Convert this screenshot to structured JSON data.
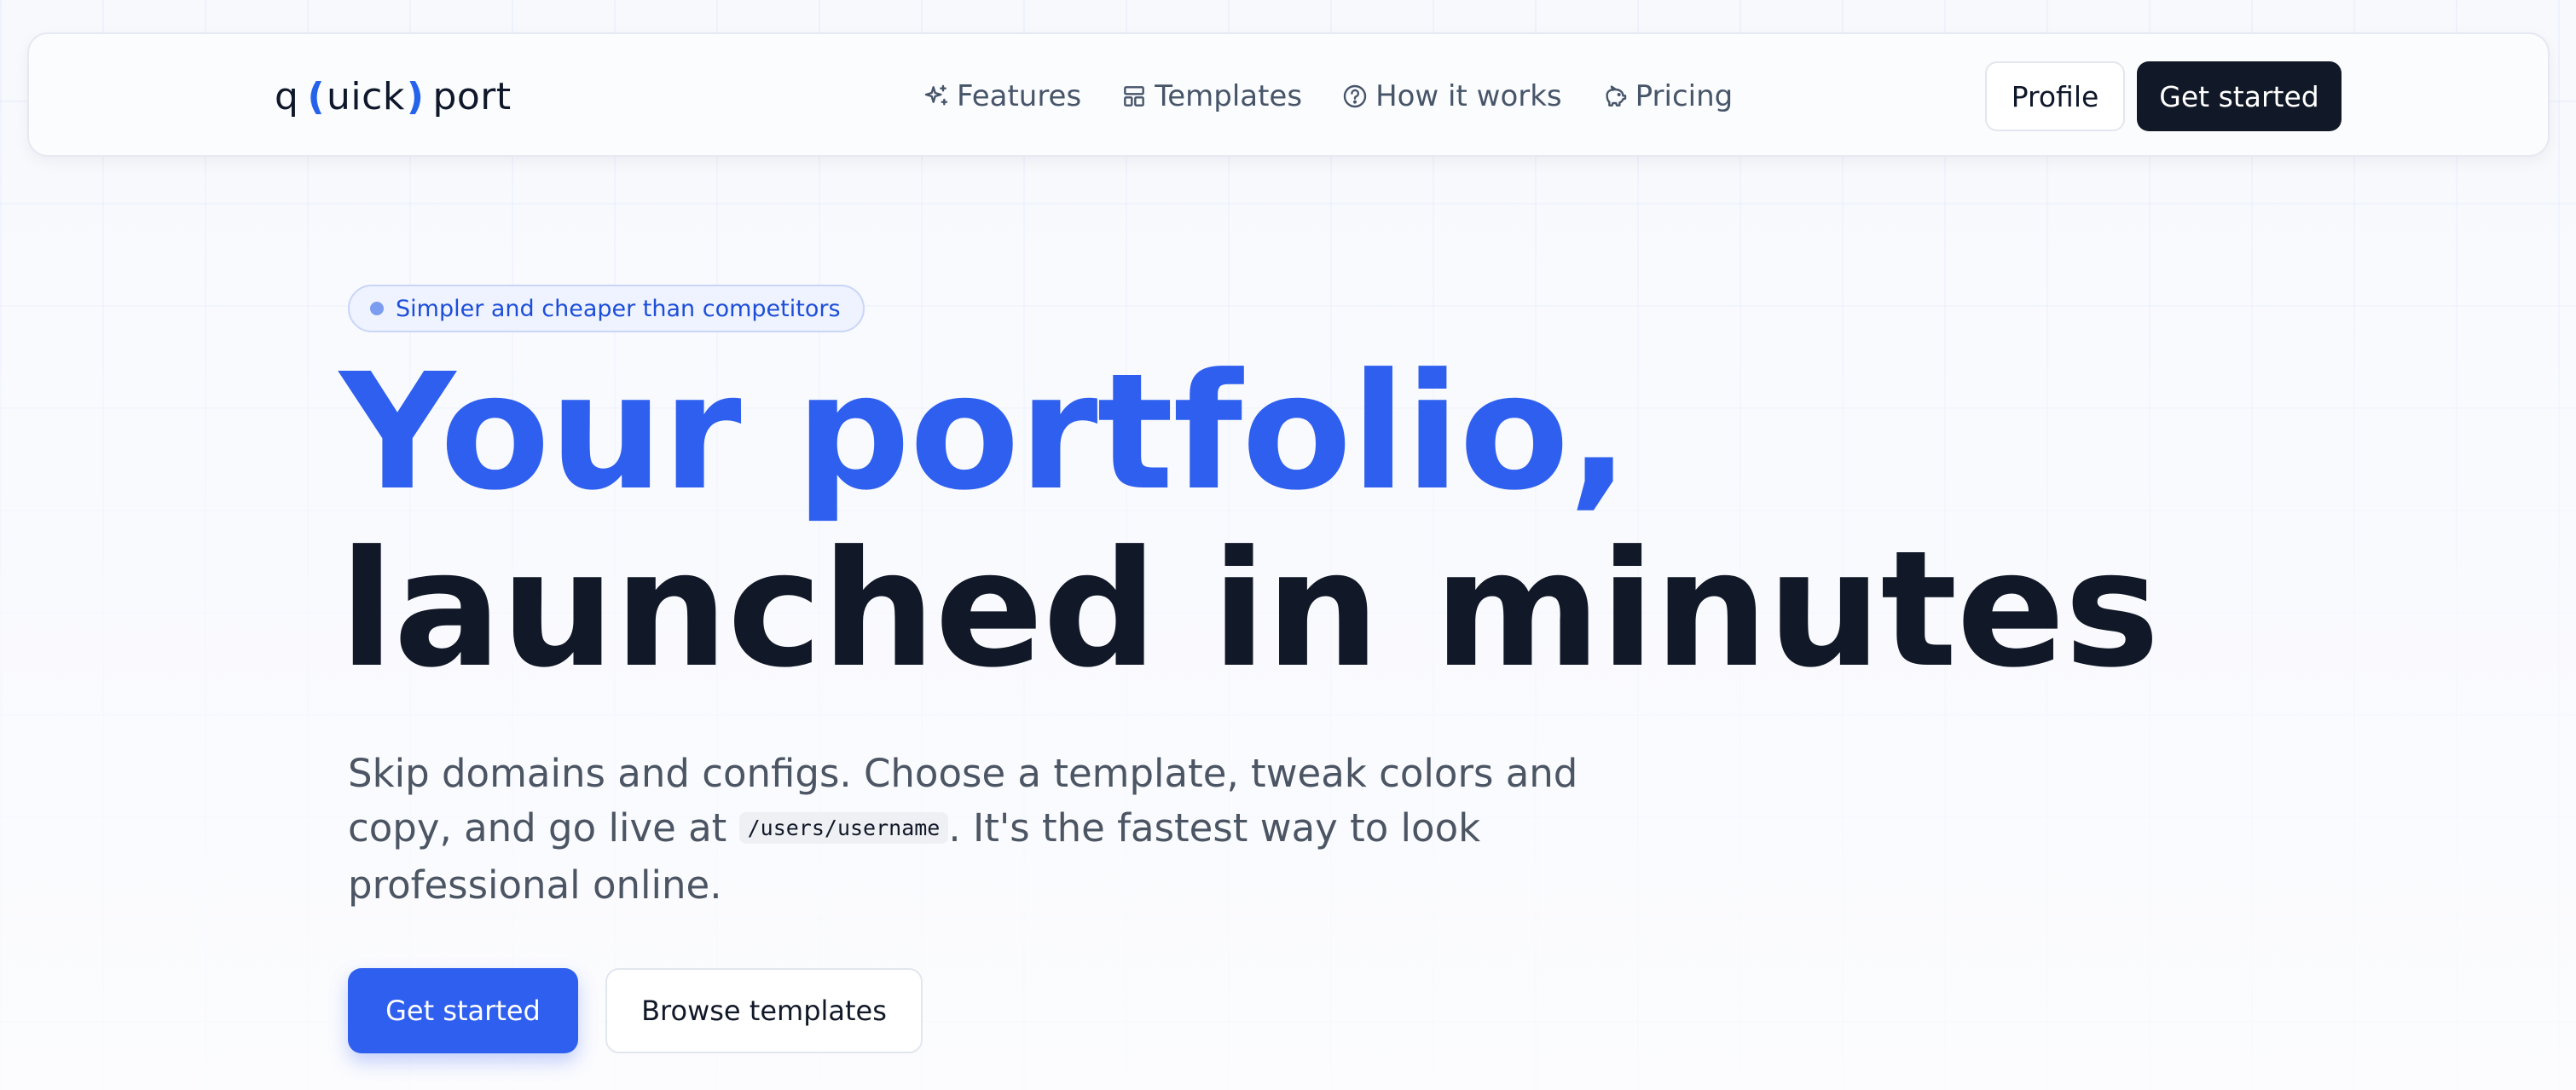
{
  "navbar": {
    "logo": {
      "start": "q",
      "open_paren": "(",
      "middle": "uick",
      "close_paren": ")",
      "end": "port"
    },
    "links": [
      {
        "label": "Features",
        "icon": "sparkles-icon"
      },
      {
        "label": "Templates",
        "icon": "layout-icon"
      },
      {
        "label": "How it works",
        "icon": "help-circle-icon"
      },
      {
        "label": "Pricing",
        "icon": "piggy-bank-icon"
      }
    ],
    "profile_label": "Profile",
    "get_started_label": "Get started"
  },
  "hero": {
    "badge": "Simpler and cheaper than competitors",
    "headline_line1": "Your portfolio,",
    "headline_line2": "launched in minutes",
    "subtext_before": "Skip domains and configs. Choose a template, tweak colors and copy, and go live at ",
    "subtext_code": "/users/username",
    "subtext_after": ". It's the fastest way to look professional online.",
    "primary_cta": "Get started",
    "secondary_cta": "Browse templates"
  },
  "colors": {
    "accent": "#2f5fef",
    "dark": "#111827",
    "text_muted": "#4b5563",
    "badge_bg": "#eef3ff"
  }
}
